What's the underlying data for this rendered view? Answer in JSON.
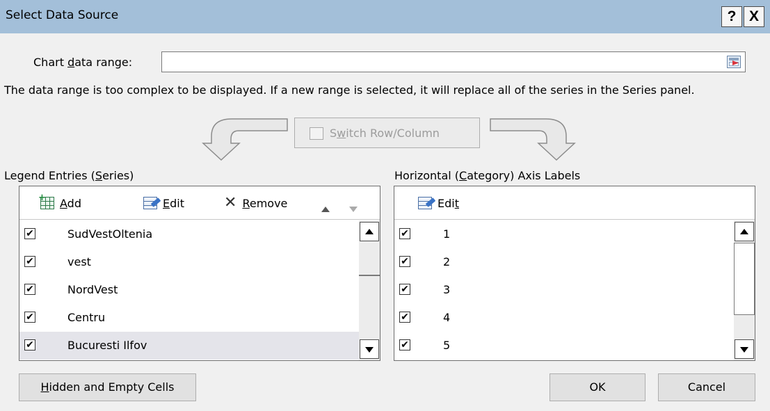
{
  "window": {
    "title": "Select Data Source",
    "help_label": "?",
    "close_label": "X"
  },
  "range": {
    "label_pre": "Chart ",
    "label_key": "d",
    "label_post": "ata range:",
    "value": ""
  },
  "info_text": "The data range is too complex to be displayed. If a new range is selected, it will replace all of the series in the Series panel.",
  "switch_button": {
    "pre": "S",
    "key": "w",
    "post": "itch Row/Column",
    "enabled": false
  },
  "legend": {
    "heading_pre": "Legend Entries (",
    "heading_key": "S",
    "heading_post": "eries)",
    "toolbar": {
      "add_key": "A",
      "add_rest": "dd",
      "edit_key": "E",
      "edit_rest": "dit",
      "remove_key": "R",
      "remove_rest": "emove"
    },
    "items": [
      {
        "label": "SudVestOltenia",
        "checked": true,
        "selected": false
      },
      {
        "label": "vest",
        "checked": true,
        "selected": false
      },
      {
        "label": "NordVest",
        "checked": true,
        "selected": false
      },
      {
        "label": "Centru",
        "checked": true,
        "selected": false
      },
      {
        "label": "Bucuresti Ilfov",
        "checked": true,
        "selected": true
      }
    ]
  },
  "axis": {
    "heading_pre": "Horizontal (",
    "heading_key": "C",
    "heading_post": "ategory) Axis Labels",
    "toolbar": {
      "edit_pre": "Edi",
      "edit_key": "t"
    },
    "items": [
      {
        "label": "1",
        "checked": true
      },
      {
        "label": "2",
        "checked": true
      },
      {
        "label": "3",
        "checked": true
      },
      {
        "label": "4",
        "checked": true
      },
      {
        "label": "5",
        "checked": true
      }
    ]
  },
  "buttons": {
    "hidden_key": "H",
    "hidden_rest": "idden and Empty Cells",
    "ok": "OK",
    "cancel": "Cancel"
  },
  "check_glyph": "✔"
}
